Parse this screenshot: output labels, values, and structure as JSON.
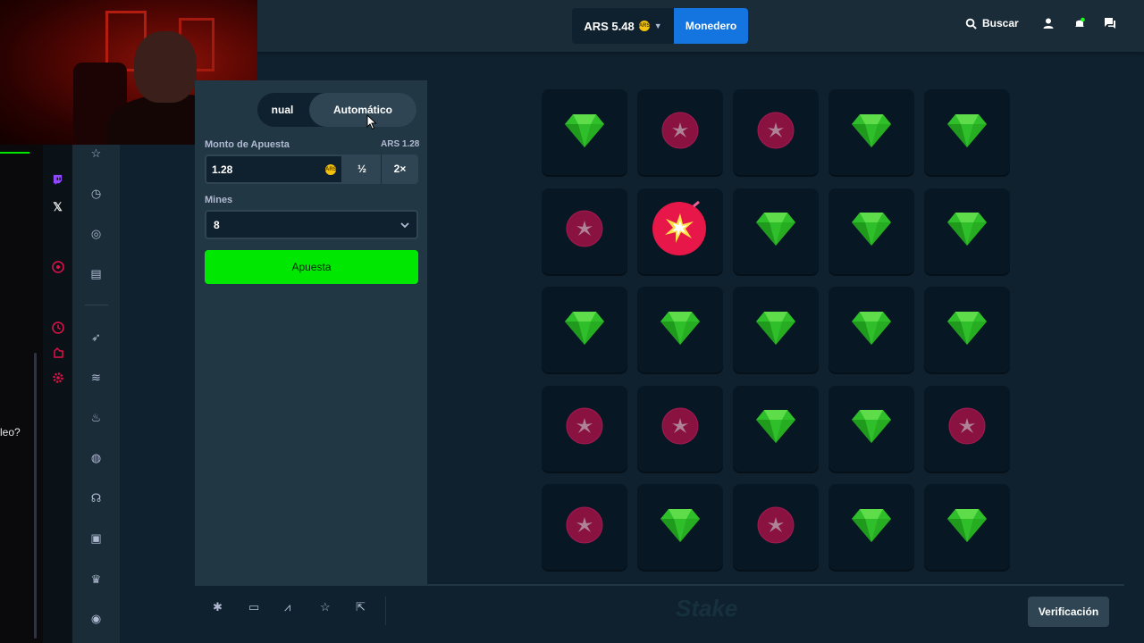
{
  "header": {
    "balance": "ARS 5.48",
    "coin_label": "ARS",
    "wallet_label": "Monedero",
    "search_label": "Buscar",
    "colors": {
      "wallet": "#1475e1",
      "header_bg": "#1a2c38",
      "page_bg": "#0f212e"
    }
  },
  "left_overlay": {
    "chat_fragment": "leo?"
  },
  "social_rail": {
    "icons": [
      "twitch-icon",
      "x-icon",
      "play-icon",
      "clock-icon",
      "puzzle-icon",
      "gear-icon"
    ]
  },
  "sidebar": {
    "icons": [
      "star-icon",
      "history-icon",
      "target-icon",
      "store-icon",
      "rocket-icon",
      "trending-icon",
      "fire-icon",
      "globe-icon",
      "headset-icon",
      "gift-icon",
      "crown-icon",
      "support-icon"
    ]
  },
  "controls": {
    "mode_tabs": {
      "manual": "nual",
      "auto": "Automático",
      "active": "auto"
    },
    "amount_label": "Monto de Apuesta",
    "amount_sub": "ARS 1.28",
    "amount_value": "1.28",
    "half_label": "½",
    "double_label": "2×",
    "mines_label": "Mines",
    "mines_value": "8",
    "bet_label": "Apuesta",
    "colors": {
      "bet_button": "#00e701",
      "panel": "#213743"
    }
  },
  "board": {
    "grid": [
      [
        "gem",
        "mine",
        "mine",
        "gem",
        "gem"
      ],
      [
        "mine",
        "bomb",
        "gem",
        "gem",
        "gem"
      ],
      [
        "gem",
        "gem",
        "gem",
        "gem",
        "gem"
      ],
      [
        "mine",
        "mine",
        "gem",
        "gem",
        "mine"
      ],
      [
        "mine",
        "gem",
        "mine",
        "gem",
        "gem"
      ]
    ],
    "colors": {
      "gem": "#2fbf2a",
      "mine": "#8a1240",
      "bomb": "#e8174a",
      "tile": "#071824"
    }
  },
  "footer": {
    "icons": [
      "settings-icon",
      "theater-icon",
      "stats-icon",
      "favorite-icon",
      "popout-icon"
    ],
    "logo": "Stake",
    "verify_label": "Verificación"
  }
}
